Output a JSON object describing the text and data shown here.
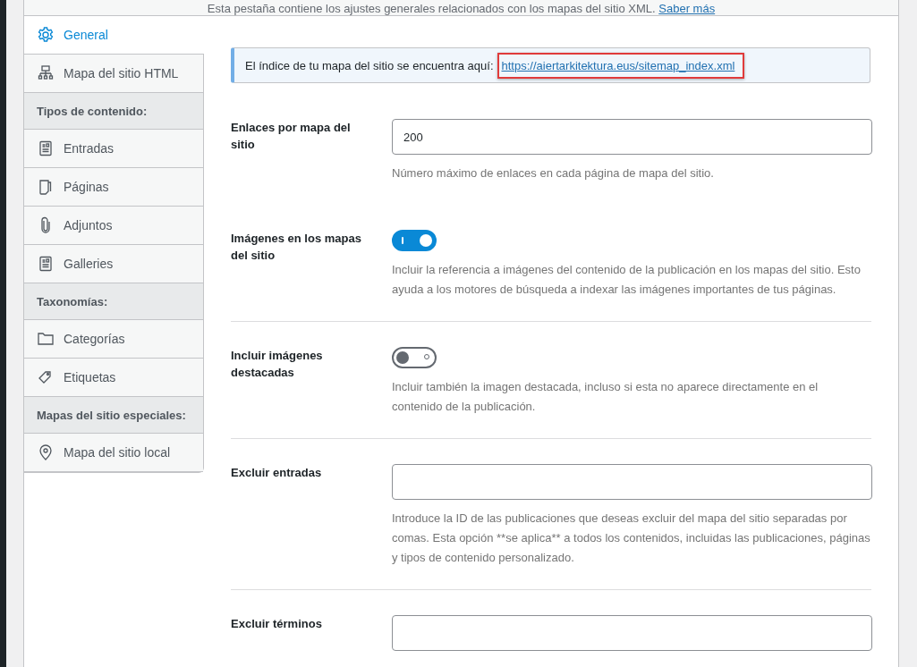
{
  "header": {
    "description": "Esta pestaña contiene los ajustes generales relacionados con los mapas del sitio XML.",
    "link": "Saber más"
  },
  "sidebar": {
    "items": [
      {
        "kind": "item",
        "label": "General",
        "selected": true
      },
      {
        "kind": "item",
        "label": "Mapa del sitio HTML",
        "selected": false
      },
      {
        "kind": "heading",
        "label": "Tipos de contenido:"
      },
      {
        "kind": "item",
        "label": "Entradas",
        "selected": false
      },
      {
        "kind": "item",
        "label": "Páginas",
        "selected": false
      },
      {
        "kind": "item",
        "label": "Adjuntos",
        "selected": false
      },
      {
        "kind": "item",
        "label": "Galleries",
        "selected": false
      },
      {
        "kind": "heading",
        "label": "Taxonomías:"
      },
      {
        "kind": "item",
        "label": "Categorías",
        "selected": false
      },
      {
        "kind": "item",
        "label": "Etiquetas",
        "selected": false
      },
      {
        "kind": "heading",
        "label": "Mapas del sitio especiales:"
      },
      {
        "kind": "item",
        "label": "Mapa del sitio local",
        "selected": false
      }
    ]
  },
  "notice": {
    "text": "El índice de tu mapa del sitio se encuentra aquí:",
    "link": "https://aiertarkitektura.eus/sitemap_index.xml",
    "highlighted": true
  },
  "settings": [
    {
      "kind": "text",
      "label": "Enlaces por mapa del sitio",
      "value": "200",
      "help": "Número máximo de enlaces en cada página de mapa del sitio."
    },
    {
      "kind": "toggle",
      "label": "Imágenes en los mapas del sitio",
      "on": true,
      "help": "Incluir la referencia a imágenes del contenido de la publicación en los mapas del sitio. Esto ayuda a los motores de búsqueda a indexar las imágenes importantes de tus páginas."
    },
    {
      "kind": "toggle",
      "label": "Incluir imágenes destacadas",
      "on": false,
      "help": "Incluir también la imagen destacada, incluso si esta no aparece directamente en el contenido de la publicación."
    },
    {
      "kind": "text",
      "label": "Excluir entradas",
      "help": "Introduce la ID de las publicaciones que deseas excluir del mapa del sitio separadas por comas. Esta opción **se aplica** a todos los contenidos, incluidas las publicaciones, páginas y tipos de contenido personalizado."
    },
    {
      "kind": "text",
      "label": "Excluir términos"
    }
  ]
}
